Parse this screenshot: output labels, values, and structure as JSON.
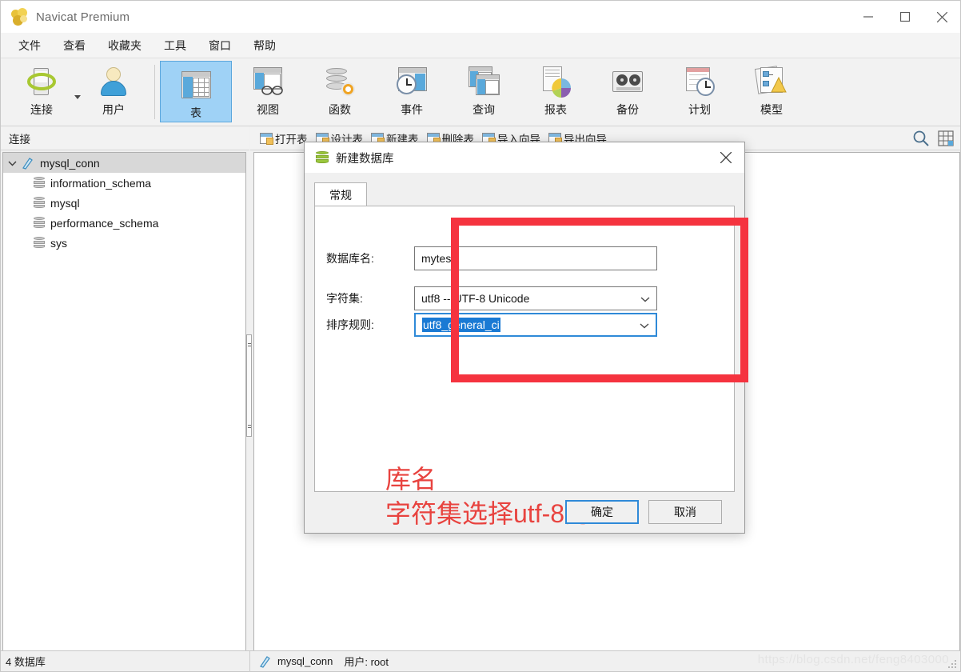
{
  "window": {
    "title": "Navicat Premium",
    "logo_icon": "navicat-logo-icon",
    "minimize_icon": "minimize-icon",
    "maximize_icon": "maximize-icon",
    "close_icon": "close-icon"
  },
  "menubar": {
    "items": [
      {
        "label": "文件"
      },
      {
        "label": "查看"
      },
      {
        "label": "收藏夹"
      },
      {
        "label": "工具"
      },
      {
        "label": "窗口"
      },
      {
        "label": "帮助"
      }
    ]
  },
  "toolbar": {
    "items": [
      {
        "label": "连接",
        "icon": "connection-icon",
        "selected": false,
        "has_dropdown": true
      },
      {
        "label": "用户",
        "icon": "user-icon",
        "selected": false,
        "has_dropdown": false
      },
      {
        "label": "表",
        "icon": "table-icon",
        "selected": true,
        "has_dropdown": false
      },
      {
        "label": "视图",
        "icon": "view-icon",
        "selected": false,
        "has_dropdown": false
      },
      {
        "label": "函数",
        "icon": "function-icon",
        "selected": false,
        "has_dropdown": false
      },
      {
        "label": "事件",
        "icon": "event-icon",
        "selected": false,
        "has_dropdown": false
      },
      {
        "label": "查询",
        "icon": "query-icon",
        "selected": false,
        "has_dropdown": false
      },
      {
        "label": "报表",
        "icon": "report-icon",
        "selected": false,
        "has_dropdown": false
      },
      {
        "label": "备份",
        "icon": "backup-icon",
        "selected": false,
        "has_dropdown": false
      },
      {
        "label": "计划",
        "icon": "schedule-icon",
        "selected": false,
        "has_dropdown": false
      },
      {
        "label": "模型",
        "icon": "model-icon",
        "selected": false,
        "has_dropdown": false
      }
    ]
  },
  "subtoolbar": {
    "items": [
      {
        "label": "打开表",
        "icon": "open-table-icon"
      },
      {
        "label": "设计表",
        "icon": "design-table-icon"
      },
      {
        "label": "新建表",
        "icon": "new-table-icon"
      },
      {
        "label": "删除表",
        "icon": "delete-table-icon"
      },
      {
        "label": "导入向导",
        "icon": "import-wizard-icon"
      },
      {
        "label": "导出向导",
        "icon": "export-wizard-icon"
      }
    ],
    "search_icon": "search-icon",
    "grid_icon": "grid-view-icon"
  },
  "sidebar": {
    "header": "连接",
    "tree": {
      "root": {
        "label": "mysql_conn",
        "icon": "connection-icon",
        "expanded": true,
        "selected": true
      },
      "children": [
        {
          "label": "information_schema",
          "icon": "database-icon"
        },
        {
          "label": "mysql",
          "icon": "database-icon"
        },
        {
          "label": "performance_schema",
          "icon": "database-icon"
        },
        {
          "label": "sys",
          "icon": "database-icon"
        }
      ]
    }
  },
  "dialog": {
    "title": "新建数据库",
    "icon": "new-database-icon",
    "close_icon": "close-icon",
    "tabs": [
      {
        "label": "常规",
        "active": true
      }
    ],
    "fields": {
      "db_name": {
        "label": "数据库名:",
        "value": "mytest",
        "placeholder": ""
      },
      "charset": {
        "label": "字符集:",
        "value": "utf8 -- UTF-8 Unicode"
      },
      "collation": {
        "label": "排序规则:",
        "value": "utf8_general_ci",
        "selected": true,
        "focused": true
      }
    },
    "annotation": {
      "line1": "库名",
      "line2": "字符集选择utf-8的",
      "color": "#e8433f"
    },
    "highlight_color": "#f5333f",
    "buttons": {
      "ok": "确定",
      "cancel": "取消"
    }
  },
  "statusbar": {
    "left": "4 数据库",
    "connection_icon": "connection-icon",
    "connection": "mysql_conn",
    "user": "用户: root",
    "watermark": "https://blog.csdn.net/feng8403000"
  },
  "colors": {
    "accent": "#2f8ad8",
    "selection": "#1a7ad4",
    "toolbar_selected": "#9fd2f6",
    "annotation_red": "#e8433f",
    "highlight_red": "#f5333f"
  }
}
